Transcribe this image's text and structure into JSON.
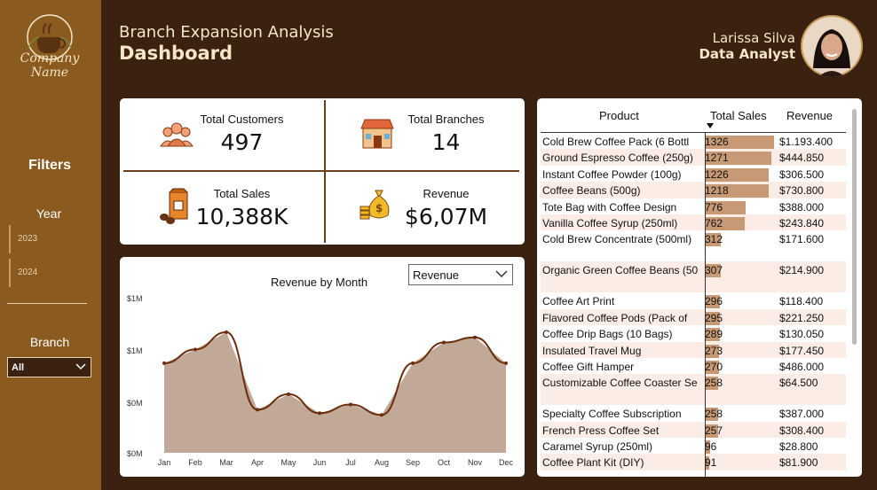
{
  "sidebar": {
    "logo_text_line1": "Company",
    "logo_text_line2": "Name",
    "filters_label": "Filters",
    "year_label": "Year",
    "years": [
      "2023",
      "2024"
    ],
    "branch_label": "Branch",
    "branch_value": "All"
  },
  "header": {
    "title_line1": "Branch Expansion Analysis",
    "title_line2": "Dashboard",
    "user_name": "Larissa Silva",
    "user_role": "Data Analyst"
  },
  "kpis": {
    "customers": {
      "label": "Total Customers",
      "value": "497",
      "icon": "customers-icon"
    },
    "branches": {
      "label": "Total Branches",
      "value": "14",
      "icon": "store-icon"
    },
    "sales": {
      "label": "Total Sales",
      "value": "10,388K",
      "icon": "coffee-bag-icon"
    },
    "revenue": {
      "label": "Revenue",
      "value": "$6,07M",
      "icon": "money-bag-icon"
    }
  },
  "chart": {
    "title": "Revenue by Month",
    "dropdown_value": "Revenue"
  },
  "chart_data": {
    "type": "area",
    "title": "Revenue by Month",
    "categories": [
      "Jan",
      "Feb",
      "Mar",
      "Apr",
      "May",
      "Jun",
      "Jul",
      "Aug",
      "Sep",
      "Oct",
      "Nov",
      "Dec"
    ],
    "y_tick_labels": [
      "$1M",
      "$1M",
      "$0M",
      "$0M"
    ],
    "series": [
      {
        "values": [
          0.62,
          0.7,
          0.8,
          0.35,
          0.44,
          0.33,
          0.38,
          0.32,
          0.62,
          0.74,
          0.77,
          0.62
        ]
      }
    ],
    "ylim": [
      0.1,
      1.0
    ],
    "fill_color": "#c2a896",
    "line_color": "#6b2d0c"
  },
  "table": {
    "headers": {
      "product": "Product",
      "sales": "Total Sales",
      "revenue": "Revenue"
    },
    "sales_max": 1326,
    "rows": [
      {
        "product": "Cold Brew Coffee Pack (6 Bottl",
        "sales": 1326,
        "sales_label": "1326",
        "revenue": "$1.193.400",
        "tall": false
      },
      {
        "product": "Ground Espresso Coffee (250g)",
        "sales": 1271,
        "sales_label": "1271",
        "revenue": "$444.850",
        "tall": false
      },
      {
        "product": "Instant Coffee Powder (100g)",
        "sales": 1226,
        "sales_label": "1226",
        "revenue": "$306.500",
        "tall": false
      },
      {
        "product": "Coffee Beans (500g)",
        "sales": 1218,
        "sales_label": "1218",
        "revenue": "$730.800",
        "tall": false
      },
      {
        "product": "Tote Bag with Coffee Design",
        "sales": 776,
        "sales_label": "776",
        "revenue": "$388.000",
        "tall": false
      },
      {
        "product": "Vanilla Coffee Syrup (250ml)",
        "sales": 762,
        "sales_label": "762",
        "revenue": "$243.840",
        "tall": false
      },
      {
        "product": "Cold Brew Concentrate (500ml)",
        "sales": 312,
        "sales_label": "312",
        "revenue": "$171.600",
        "tall": true
      },
      {
        "product": "Organic Green Coffee Beans (50",
        "sales": 307,
        "sales_label": "307",
        "revenue": "$214.900",
        "tall": true
      },
      {
        "product": "Coffee Art Print",
        "sales": 296,
        "sales_label": "296",
        "revenue": "$118.400",
        "tall": false
      },
      {
        "product": "Flavored Coffee Pods (Pack of",
        "sales": 295,
        "sales_label": "295",
        "revenue": "$221.250",
        "tall": false
      },
      {
        "product": "Coffee Drip Bags (10 Bags)",
        "sales": 289,
        "sales_label": "289",
        "revenue": "$130.050",
        "tall": false
      },
      {
        "product": "Insulated Travel Mug",
        "sales": 273,
        "sales_label": "273",
        "revenue": "$177.450",
        "tall": false
      },
      {
        "product": "Coffee Gift Hamper",
        "sales": 270,
        "sales_label": "270",
        "revenue": "$486.000",
        "tall": false
      },
      {
        "product": "Customizable Coffee Coaster Se",
        "sales": 258,
        "sales_label": "258",
        "revenue": "$64.500",
        "tall": true
      },
      {
        "product": "Specialty Coffee Subscription",
        "sales": 258,
        "sales_label": "258",
        "revenue": "$387.000",
        "tall": false
      },
      {
        "product": "French Press Coffee Set",
        "sales": 257,
        "sales_label": "257",
        "revenue": "$308.400",
        "tall": false
      },
      {
        "product": "Caramel Syrup (250ml)",
        "sales": 96,
        "sales_label": "96",
        "revenue": "$28.800",
        "tall": false
      },
      {
        "product": "Coffee Plant Kit (DIY)",
        "sales": 91,
        "sales_label": "91",
        "revenue": "$81.900",
        "tall": false
      }
    ]
  }
}
